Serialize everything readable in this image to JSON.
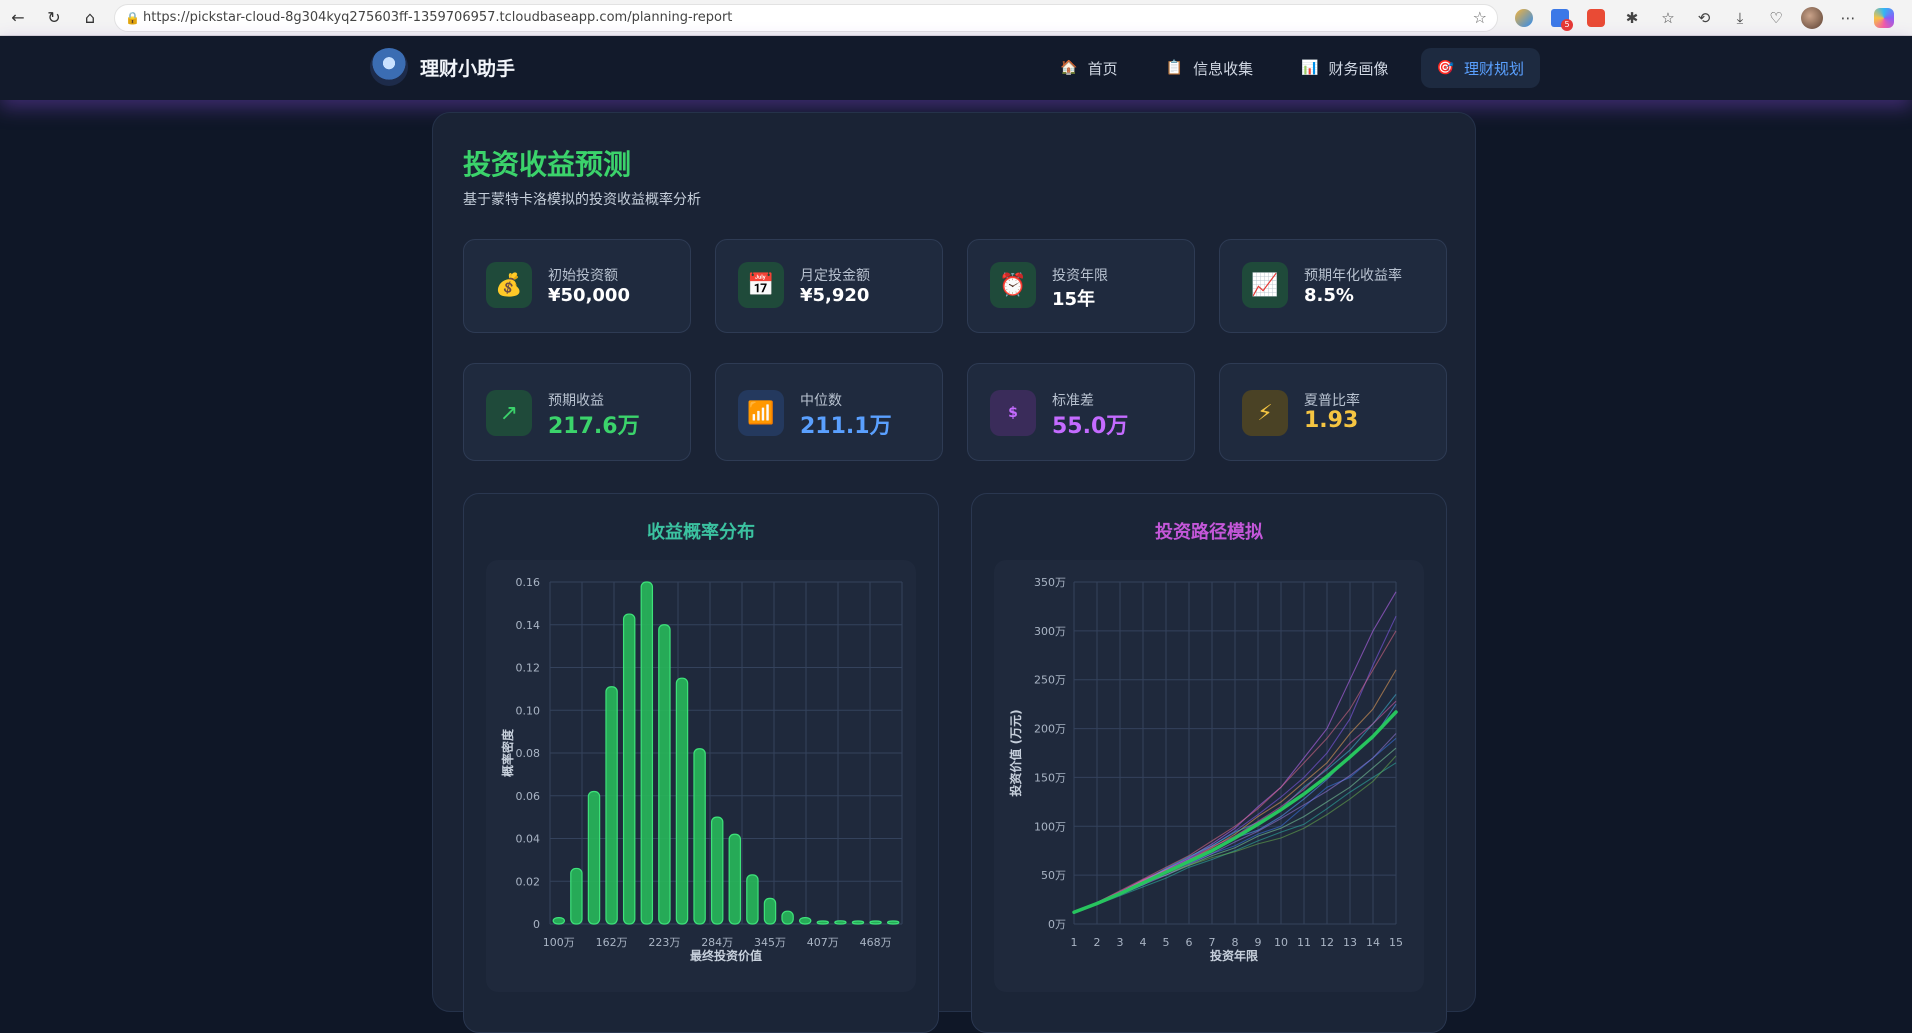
{
  "browser": {
    "url": "https://pickstar-cloud-8g304kyq275603ff-1359706957.tcloudbaseapp.com/planning-report"
  },
  "app": {
    "brand": "理财小助手",
    "nav": [
      {
        "label": "首页",
        "icon": "🏠"
      },
      {
        "label": "信息收集",
        "icon": "📋"
      },
      {
        "label": "财务画像",
        "icon": "📊"
      },
      {
        "label": "理财规划",
        "icon": "🎯"
      }
    ]
  },
  "report": {
    "title": "投资收益预测",
    "subtitle": "基于蒙特卡洛模拟的投资收益概率分析",
    "inputs": [
      {
        "label": "初始投资额",
        "value": "¥50,000",
        "icon": "💰"
      },
      {
        "label": "月定投金额",
        "value": "¥5,920",
        "icon": "📅"
      },
      {
        "label": "投资年限",
        "value": "15年",
        "icon": "⏰"
      },
      {
        "label": "预期年化收益率",
        "value": "8.5%",
        "icon": "📈"
      }
    ],
    "results": [
      {
        "label": "预期收益",
        "value": "217.6万",
        "icon": "↗",
        "color": "#3bd36b",
        "bg": "#1f4a3a"
      },
      {
        "label": "中位数",
        "value": "211.1万",
        "icon": "📶",
        "color": "#5aa0ff",
        "bg": "#24395e"
      },
      {
        "label": "标准差",
        "value": "55.0万",
        "icon": "$",
        "color": "#c46bff",
        "bg": "#3a2c5a"
      },
      {
        "label": "夏普比率",
        "value": "1.93",
        "icon": "⚡",
        "color": "#f5c542",
        "bg": "#4a4225"
      }
    ]
  },
  "chart_data": [
    {
      "type": "bar",
      "title": "收益概率分布",
      "xlabel": "最终投资价值",
      "ylabel": "概率密度",
      "ylim": [
        0,
        0.16
      ],
      "yticks": [
        "0",
        "0.02",
        "0.04",
        "0.06",
        "0.08",
        "0.10",
        "0.12",
        "0.14",
        "0.16"
      ],
      "xtick_labels": [
        "100万",
        "162万",
        "223万",
        "284万",
        "345万",
        "407万",
        "468万"
      ],
      "values": [
        0.003,
        0.026,
        0.062,
        0.111,
        0.145,
        0.16,
        0.14,
        0.115,
        0.082,
        0.05,
        0.042,
        0.023,
        0.012,
        0.006,
        0.003,
        0.001,
        0.0015,
        0.001,
        0,
        0.0005
      ],
      "color": "#27b85a",
      "grid": true
    },
    {
      "type": "line",
      "title": "投资路径模拟",
      "xlabel": "投资年限",
      "ylabel": "投资价值 (万元)",
      "x": [
        1,
        2,
        3,
        4,
        5,
        6,
        7,
        8,
        9,
        10,
        11,
        12,
        13,
        14,
        15
      ],
      "ylim": [
        0,
        350
      ],
      "ytick_labels": [
        "0万",
        "50万",
        "100万",
        "150万",
        "200万",
        "250万",
        "300万",
        "350万"
      ],
      "mean_series": [
        12,
        21,
        31,
        42,
        53,
        64,
        75,
        88,
        102,
        117,
        133,
        151,
        171,
        192,
        217
      ],
      "mean_color": "#27c45e",
      "grid": true,
      "paths": [
        [
          12,
          22,
          33,
          44,
          56,
          67,
          80,
          95,
          112,
          130,
          150,
          175,
          210,
          265,
          315
        ],
        [
          11,
          20,
          30,
          40,
          52,
          62,
          72,
          80,
          92,
          100,
          120,
          140,
          150,
          170,
          190
        ],
        [
          12,
          21,
          32,
          45,
          56,
          68,
          82,
          98,
          120,
          140,
          170,
          200,
          250,
          300,
          340
        ],
        [
          12,
          20,
          29,
          38,
          47,
          58,
          66,
          75,
          85,
          94,
          102,
          118,
          135,
          150,
          165
        ],
        [
          12,
          22,
          34,
          46,
          58,
          70,
          85,
          100,
          118,
          140,
          165,
          190,
          220,
          260,
          300
        ],
        [
          11,
          21,
          31,
          41,
          54,
          66,
          76,
          88,
          96,
          110,
          128,
          148,
          172,
          190,
          225
        ],
        [
          12,
          21,
          30,
          42,
          50,
          60,
          70,
          78,
          90,
          98,
          110,
          125,
          140,
          160,
          180
        ],
        [
          12,
          22,
          32,
          44,
          55,
          65,
          78,
          92,
          110,
          125,
          145,
          165,
          195,
          220,
          260
        ],
        [
          11,
          20,
          30,
          40,
          50,
          61,
          72,
          84,
          95,
          108,
          122,
          136,
          152,
          170,
          195
        ],
        [
          12,
          21,
          31,
          43,
          57,
          69,
          80,
          94,
          104,
          118,
          140,
          158,
          178,
          205,
          235
        ],
        [
          12,
          21,
          30,
          41,
          52,
          60,
          68,
          74,
          82,
          88,
          98,
          112,
          128,
          146,
          172
        ],
        [
          12,
          22,
          33,
          45,
          55,
          66,
          79,
          90,
          105,
          120,
          138,
          160,
          185,
          205,
          228
        ]
      ]
    }
  ]
}
